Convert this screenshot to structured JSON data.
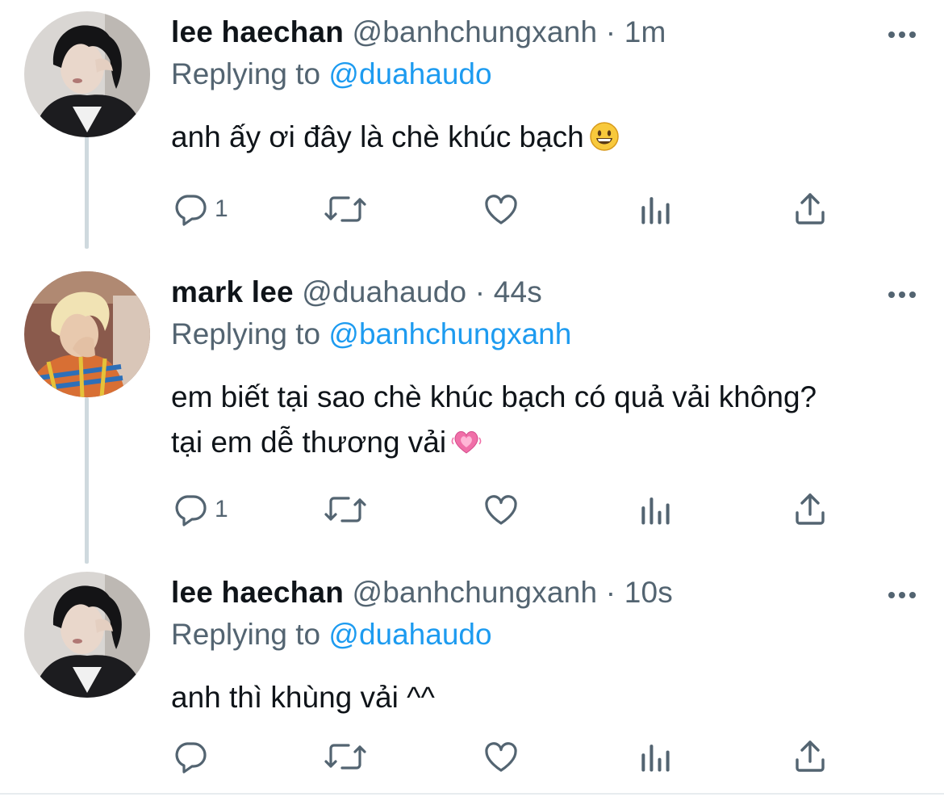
{
  "tweets": [
    {
      "display_name": "lee haechan",
      "handle": "@banhchungxanh",
      "separator": "·",
      "time": "1m",
      "replying_prefix": "Replying to",
      "replying_to": "@duahaudo",
      "text_lines": [
        "anh ấy ơi đây là chè khúc bạch"
      ],
      "emoji": "grinning-face-emoji",
      "reply_count": "1",
      "avatar": "avatar-dark-hair"
    },
    {
      "display_name": "mark lee",
      "handle": "@duahaudo",
      "separator": "·",
      "time": "44s",
      "replying_prefix": "Replying to",
      "replying_to": "@banhchungxanh",
      "text_lines": [
        "em biết tại sao chè khúc bạch có quả vải không?",
        "tại em dễ thương vải"
      ],
      "emoji": "heart-emoji",
      "reply_count": "1",
      "avatar": "avatar-blond-hair"
    },
    {
      "display_name": "lee haechan",
      "handle": "@banhchungxanh",
      "separator": "·",
      "time": "10s",
      "replying_prefix": "Replying to",
      "replying_to": "@duahaudo",
      "text_lines": [
        "anh thì khùng vải ^^"
      ],
      "emoji": "",
      "reply_count": "",
      "avatar": "avatar-dark-hair"
    }
  ],
  "icons": {
    "reply": "reply-icon",
    "retweet": "retweet-icon",
    "like": "like-icon",
    "analytics": "analytics-icon",
    "share": "share-icon",
    "more": "more-icon"
  },
  "colors": {
    "text": "#0f1419",
    "secondary": "#536471",
    "link": "#1d9bf0",
    "thread_line": "#cfd9de"
  }
}
